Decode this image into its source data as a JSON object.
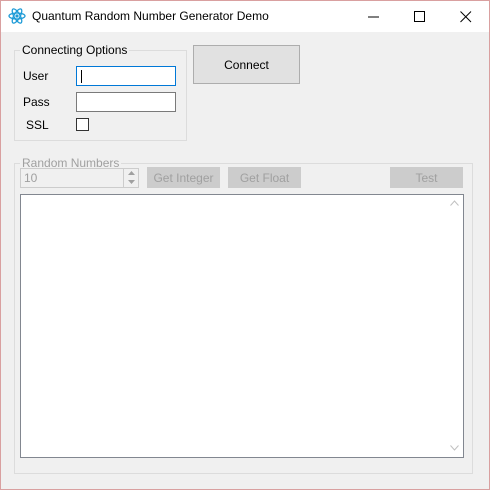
{
  "window": {
    "title": "Quantum Random Number Generator Demo",
    "app_icon": "atom-icon",
    "controls": {
      "minimize_icon": "minimize-icon",
      "maximize_icon": "maximize-icon",
      "close_icon": "close-icon"
    }
  },
  "connecting_options": {
    "legend": "Connecting Options",
    "user_label": "User",
    "user_value": "",
    "pass_label": "Pass",
    "pass_value": "",
    "ssl_label": "SSL",
    "ssl_checked": false
  },
  "connect_button": {
    "label": "Connect"
  },
  "random_numbers": {
    "legend": "Random Numbers",
    "count_value": "10",
    "get_integer_label": "Get Integer",
    "get_float_label": "Get Float",
    "test_label": "Test",
    "output_text": ""
  },
  "colors": {
    "accent": "#0078d7",
    "disabled_text": "#a0a0a0",
    "window_bg": "#f0f0f0",
    "icon_color": "#1e9bd7"
  }
}
